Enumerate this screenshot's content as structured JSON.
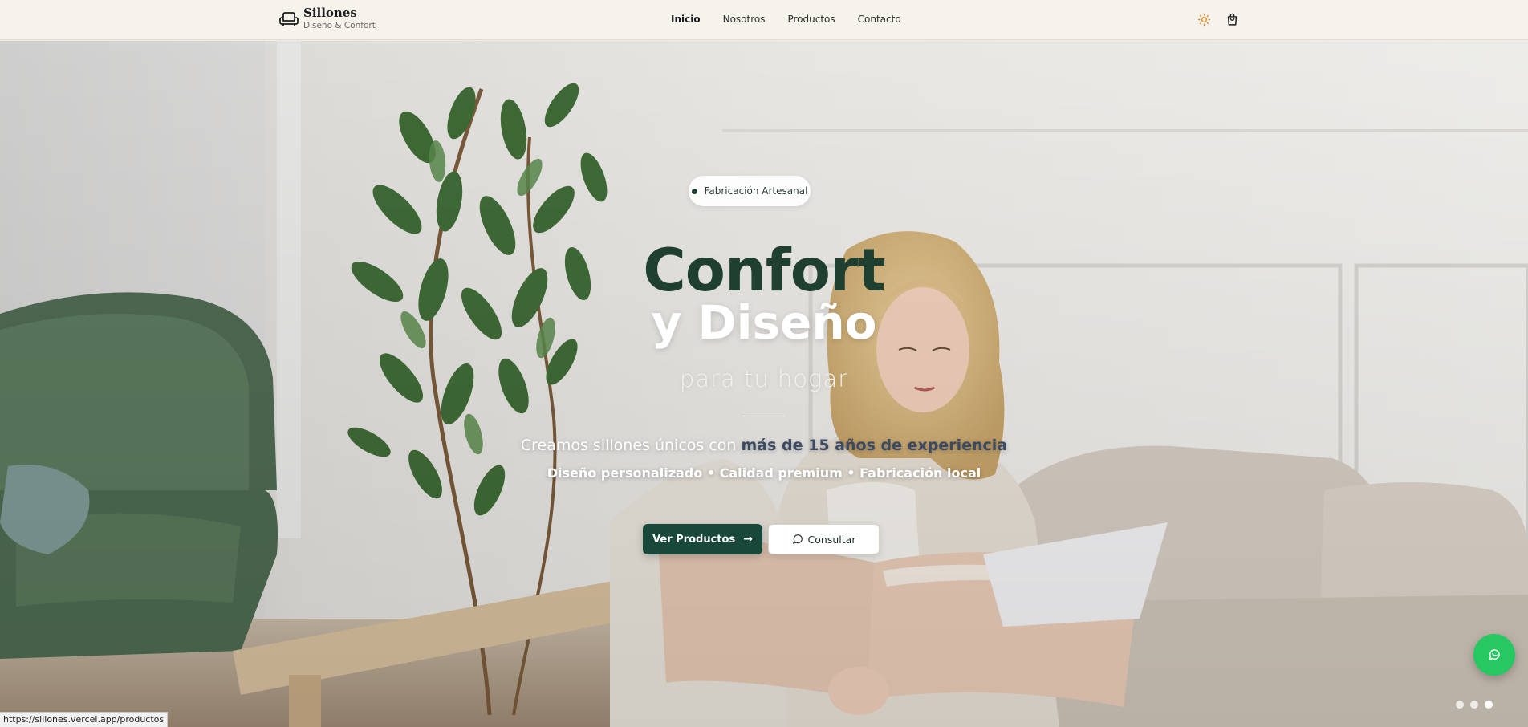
{
  "brand": {
    "title": "Sillones",
    "subtitle": "Diseño & Confort",
    "icon": "sofa-icon"
  },
  "nav": {
    "links": [
      {
        "label": "Inicio",
        "active": true
      },
      {
        "label": "Nosotros",
        "active": false
      },
      {
        "label": "Productos",
        "active": false
      },
      {
        "label": "Contacto",
        "active": false
      }
    ],
    "actions": [
      "sun-icon",
      "shopping-bag-icon"
    ]
  },
  "hero": {
    "badge": "Fabricación Artesanal",
    "title_line1": "Confort",
    "title_line2": "y Diseño",
    "title_line3": "para tu hogar",
    "lead_prefix": "Creamos sillones únicos con ",
    "lead_highlight": "más de 15 años de experiencia",
    "features": "Diseño personalizado • Calidad premium • Fabricación local",
    "primary_button": "Ver Productos",
    "secondary_button": "Consultar",
    "slide_count": 3,
    "active_slide": 3
  },
  "whatsapp_icon": "whatsapp-icon",
  "status_bar": {
    "url": "https://sillones.vercel.app/productos"
  },
  "colors": {
    "accent_green": "#17483a",
    "title_green": "#1f4030",
    "whatsapp_green": "#25c861",
    "sun_orange": "#e0902a"
  }
}
